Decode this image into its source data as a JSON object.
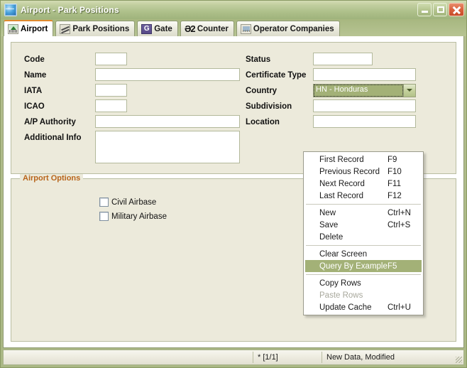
{
  "window": {
    "title": "Airport - Park Positions",
    "icon": "globe-icon",
    "minimize_label": "",
    "maximize_label": "",
    "close_label": ""
  },
  "tabs": [
    {
      "label": "Airport",
      "icon": "airport-icon",
      "active": true
    },
    {
      "label": "Park Positions",
      "icon": "park-icon",
      "active": false
    },
    {
      "label": "Gate",
      "icon": "gate-icon",
      "glyph": "G",
      "active": false
    },
    {
      "label": "Counter",
      "icon": "counter-icon",
      "glyph": "Ə2",
      "active": false
    },
    {
      "label": "Operator Companies",
      "icon": "operator-icon",
      "active": false
    }
  ],
  "form": {
    "left_fields": [
      {
        "label": "Code",
        "value": ""
      },
      {
        "label": "Name",
        "value": ""
      },
      {
        "label": "IATA",
        "value": ""
      },
      {
        "label": "ICAO",
        "value": ""
      },
      {
        "label": "A/P Authority",
        "value": ""
      },
      {
        "label": "Additional Info",
        "value": ""
      }
    ],
    "right_fields": [
      {
        "label": "Status",
        "value": ""
      },
      {
        "label": "Certificate Type",
        "value": ""
      },
      {
        "label": "Country",
        "value": "HN - Honduras",
        "type": "combobox",
        "focused": true
      },
      {
        "label": "Subdivision",
        "value": ""
      },
      {
        "label": "Location",
        "value": ""
      }
    ]
  },
  "options_group": {
    "legend": "Airport Options",
    "checkboxes": [
      {
        "label": "Civil Airbase",
        "checked": false
      },
      {
        "label": "Military Airbase",
        "checked": false
      }
    ]
  },
  "context_menu": {
    "items": [
      {
        "label": "First Record",
        "accel": "F9",
        "state": "normal"
      },
      {
        "label": "Previous Record",
        "accel": "F10",
        "state": "normal"
      },
      {
        "label": "Next Record",
        "accel": "F11",
        "state": "normal"
      },
      {
        "label": "Last Record",
        "accel": "F12",
        "state": "normal"
      },
      {
        "separator": true
      },
      {
        "label": "New",
        "accel": "Ctrl+N",
        "state": "normal"
      },
      {
        "label": "Save",
        "accel": "Ctrl+S",
        "state": "normal"
      },
      {
        "label": "Delete",
        "accel": "",
        "state": "normal"
      },
      {
        "separator": true
      },
      {
        "label": "Clear Screen",
        "accel": "",
        "state": "normal"
      },
      {
        "label": "Query By Example",
        "accel": "F5",
        "state": "selected"
      },
      {
        "separator": true
      },
      {
        "label": "Copy Rows",
        "accel": "",
        "state": "normal"
      },
      {
        "label": "Paste Rows",
        "accel": "",
        "state": "disabled"
      },
      {
        "label": "Update Cache",
        "accel": "Ctrl+U",
        "state": "normal"
      }
    ]
  },
  "statusbar": {
    "record": "* [1/1]",
    "message": "New Data, Modified"
  },
  "colors": {
    "titlebar": "#aec08a",
    "panel_bg": "#eceadb",
    "accent_orange": "#e08a2e",
    "legend_text": "#b8651b",
    "highlight": "#a3b177",
    "close_button": "#d9613c"
  }
}
